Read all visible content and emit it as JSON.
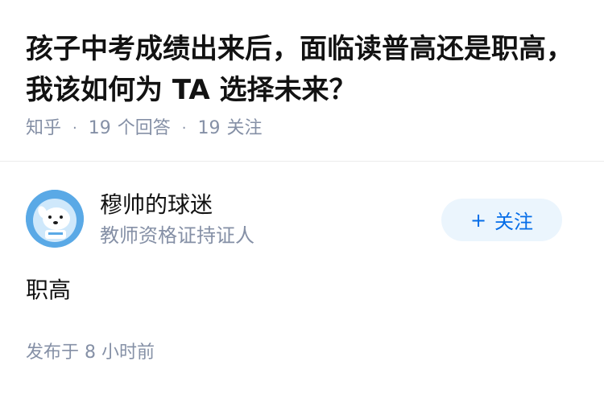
{
  "question": {
    "title": "孩子中考成绩出来后，面临读普高还是职高，我该如何为 TA 选择未来？",
    "source": "知乎",
    "answer_count": "19",
    "answer_label": "个回答",
    "follower_count": "19",
    "follower_label": "关注"
  },
  "answer": {
    "author_name": "穆帅的球迷",
    "author_badge": "教师资格证持证人",
    "follow_label": "关注",
    "follow_icon": "plus-icon",
    "content": "职高",
    "time_label": "发布于",
    "time_value": "8 小时前"
  },
  "colors": {
    "accent": "#056de8",
    "follow_bg": "#ebf5fd",
    "meta_gray": "#8590a6",
    "avatar_blue": "#5aa9e6"
  }
}
